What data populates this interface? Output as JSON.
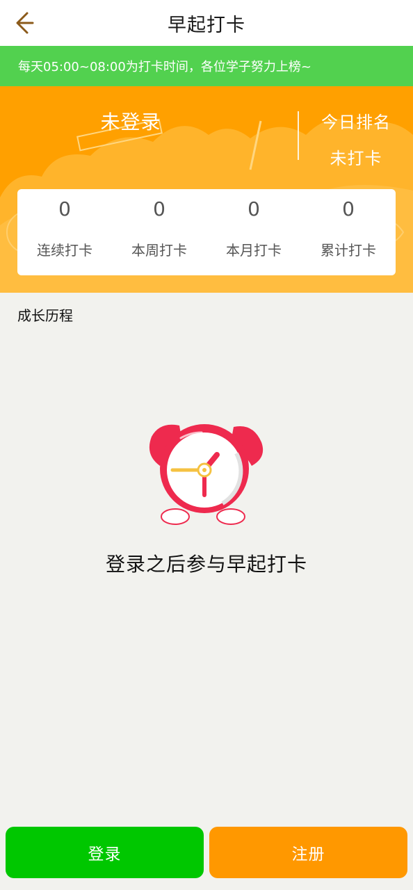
{
  "header": {
    "title": "早起打卡",
    "back_icon": "arrow-left-icon",
    "back_color": "#8b5a1a"
  },
  "notice": {
    "text": "每天05:00~08:00为打卡时间，各位学子努力上榜~",
    "color": "#52d14f"
  },
  "profile": {
    "name": "未登录",
    "rank_label": "今日排名",
    "rank_value": "未打卡",
    "background_color": "#ffa000"
  },
  "stats": [
    {
      "value": "0",
      "label": "连续打卡"
    },
    {
      "value": "0",
      "label": "本周打卡"
    },
    {
      "value": "0",
      "label": "本月打卡"
    },
    {
      "value": "0",
      "label": "累计打卡"
    }
  ],
  "section": {
    "title": "成长历程"
  },
  "empty_state": {
    "icon": "alarm-clock-icon",
    "message": "登录之后参与早起打卡"
  },
  "actions": {
    "login_label": "登录",
    "register_label": "注册",
    "login_color": "#00c700",
    "register_color": "#ff9800"
  }
}
